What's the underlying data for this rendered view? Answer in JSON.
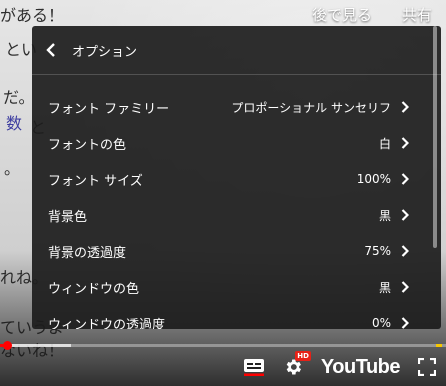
{
  "top_actions": {
    "watch_later": "後で見る",
    "share": "共有"
  },
  "background_text": {
    "line1": "がある！",
    "line2": "とい",
    "line3": "だ。",
    "line4": "数",
    "line5": "と",
    "line6": "。",
    "line7": "れね。",
    "line8": "ていうよ",
    "line9": "ないね！"
  },
  "menu": {
    "title": "オプション",
    "items": [
      {
        "label": "フォント ファミリー",
        "value": "プロポーショナル サンセリフ"
      },
      {
        "label": "フォントの色",
        "value": "白"
      },
      {
        "label": "フォント サイズ",
        "value": "100%"
      },
      {
        "label": "背景色",
        "value": "黒"
      },
      {
        "label": "背景の透過度",
        "value": "75%"
      },
      {
        "label": "ウィンドウの色",
        "value": "黒"
      },
      {
        "label": "ウィンドウの透過度",
        "value": "0%"
      }
    ]
  },
  "player": {
    "progress_played": 0.015,
    "progress_buffered": 0.16,
    "hd_badge": "HD",
    "brand": "YouTube",
    "colors": {
      "played": "#ff0000",
      "subtitle_active_underline": "#ff0000",
      "hd_badge": "#e62117",
      "ad_marker": "#f7c700",
      "menu_bg": "#1c1c1c"
    },
    "icons": [
      "back-chevron-icon",
      "subtitles-icon",
      "settings-gear-icon",
      "fullscreen-icon"
    ]
  }
}
